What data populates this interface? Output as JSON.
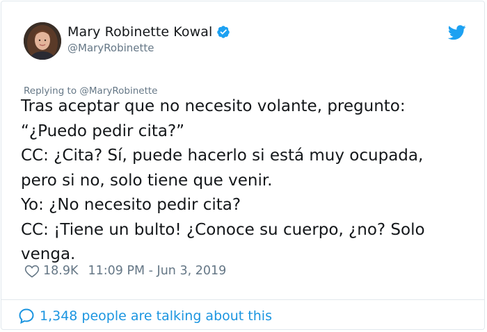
{
  "tweet": {
    "author": {
      "display_name": "Mary Robinette Kowal",
      "handle": "@MaryRobinette",
      "verified": true
    },
    "reply_to": "Replying to @MaryRobinette",
    "text": "Tras aceptar que no necesito volante, pregunto:\n“¿Puedo pedir cita?”\nCC: ¿Cita? Sí, puede hacerlo si está muy ocupada,\npero si no, solo tiene que venir.\nYo: ¿No necesito pedir cita?\nCC: ¡Tiene un bulto! ¿Conoce su cuerpo, ¿no? Solo\nvenga.",
    "likes": "18.9K",
    "timestamp": "11:09 PM - Jun 3, 2019",
    "talking_about": "1,348 people are talking about this"
  },
  "icons": {
    "verified": "verified-badge-icon",
    "brand": "twitter-bird-icon",
    "like": "heart-icon",
    "conversation": "speech-bubble-icon"
  },
  "colors": {
    "accent": "#1da1f2",
    "link": "#1b95e0",
    "muted": "#657786",
    "text": "#14171a",
    "border": "#e1e8ed"
  }
}
